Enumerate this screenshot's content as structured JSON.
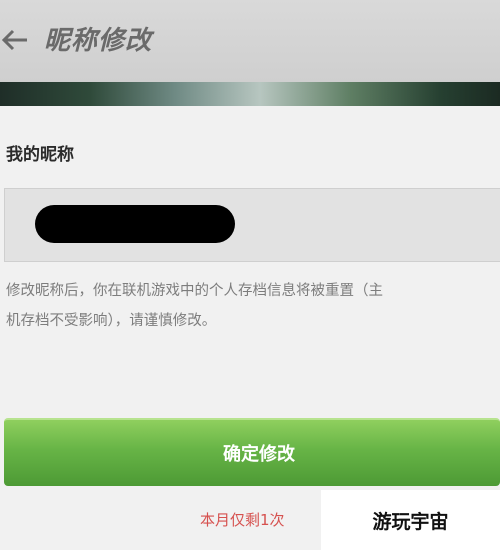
{
  "header": {
    "title": "昵称修改"
  },
  "form": {
    "label": "我的昵称",
    "nickname_value": "",
    "description_line1": "修改昵称后，你在联机游戏中的个人存档信息将被重置（主",
    "description_line2": "机存档不受影响），请谨慎修改。"
  },
  "actions": {
    "confirm_label": "确定修改",
    "remaining_text": "本月仅剩1次"
  },
  "watermark": {
    "text": "游玩宇宙"
  },
  "colors": {
    "confirm_green": "#5aa83c",
    "remaining_red": "#d6514f",
    "header_gray": "#d3d3d3"
  },
  "icons": {
    "back": "back-arrow-icon"
  }
}
